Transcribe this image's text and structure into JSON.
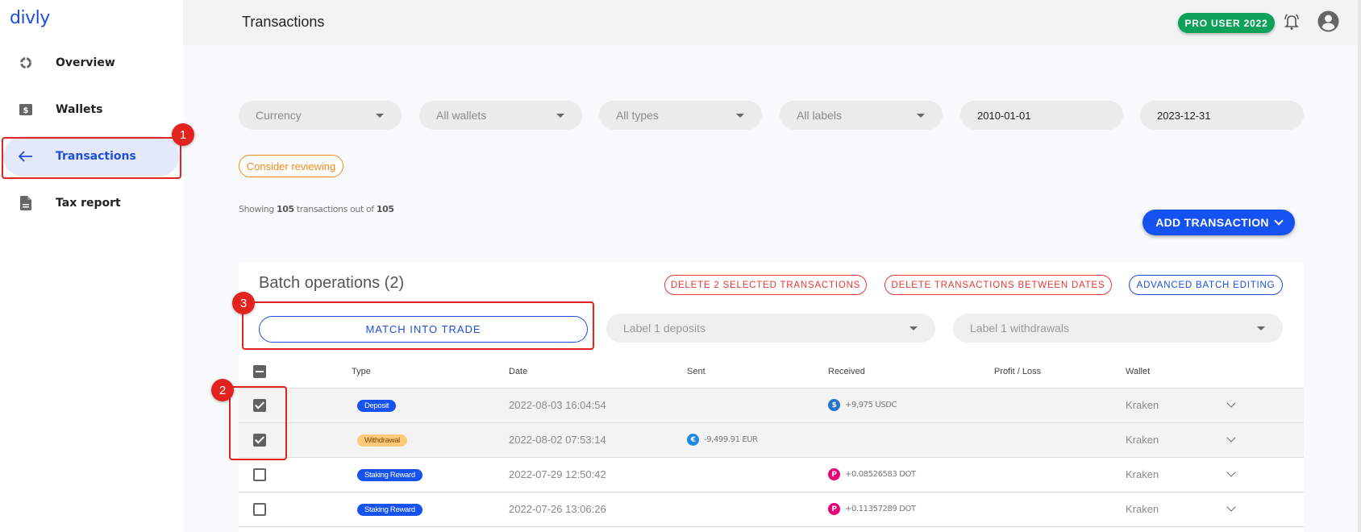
{
  "app": {
    "logo": "divly",
    "page_title": "Transactions"
  },
  "sidebar": {
    "items": [
      {
        "label": "Overview",
        "icon": "overview-ring-icon",
        "active": false
      },
      {
        "label": "Wallets",
        "icon": "wallet-dollar-icon",
        "active": false
      },
      {
        "label": "Transactions",
        "icon": "arrow-left-icon",
        "active": true
      },
      {
        "label": "Tax report",
        "icon": "document-icon",
        "active": false
      }
    ]
  },
  "topbar": {
    "badge": "PRO USER 2022",
    "badge_color": "#0ea15a",
    "icons": [
      "bell-icon",
      "account-circle-icon"
    ]
  },
  "filters": {
    "currency": {
      "placeholder": "Currency"
    },
    "wallets": {
      "value": "All wallets"
    },
    "types": {
      "value": "All types"
    },
    "labels": {
      "value": "All labels"
    },
    "date_from": "2010-01-01",
    "date_to": "2023-12-31"
  },
  "review_chip": "Consider reviewing",
  "summary": {
    "prefix": "Showing",
    "shown": "105",
    "middle": "transactions out of",
    "total": "105"
  },
  "add_transaction": "ADD TRANSACTION",
  "batch": {
    "title": "Batch operations (2)",
    "delete_selected": "DELETE 2 SELECTED TRANSACTIONS",
    "delete_between": "DELETE TRANSACTIONS BETWEEN DATES",
    "advanced": "ADVANCED BATCH EDITING",
    "match": "MATCH INTO TRADE",
    "label_deposits": "Label 1 deposits",
    "label_withdrawals": "Label 1 withdrawals"
  },
  "table": {
    "columns": [
      "Type",
      "Date",
      "Sent",
      "Received",
      "Profit / Loss",
      "Wallet"
    ],
    "rows": [
      {
        "selected": true,
        "type": "Deposit",
        "type_style": "blue",
        "date": "2022-08-03 16:04:54",
        "sent": "",
        "sent_coin": "",
        "received": "+9,975 USDC",
        "received_coin": "usdc",
        "profit_loss": "",
        "wallet": "Kraken"
      },
      {
        "selected": true,
        "type": "Withdrawal",
        "type_style": "orange",
        "date": "2022-08-02 07:53:14",
        "sent": "-9,499.91 EUR",
        "sent_coin": "eur",
        "received": "",
        "received_coin": "",
        "profit_loss": "",
        "wallet": "Kraken"
      },
      {
        "selected": false,
        "type": "Staking Reward",
        "type_style": "blue",
        "date": "2022-07-29 12:50:42",
        "sent": "",
        "sent_coin": "",
        "received": "+0.08526583 DOT",
        "received_coin": "dot",
        "profit_loss": "",
        "wallet": "Kraken"
      },
      {
        "selected": false,
        "type": "Staking Reward",
        "type_style": "blue",
        "date": "2022-07-26 13:06:26",
        "sent": "",
        "sent_coin": "",
        "received": "+0.11357289 DOT",
        "received_coin": "dot",
        "profit_loss": "",
        "wallet": "Kraken"
      }
    ]
  },
  "annotations": [
    "1",
    "2",
    "3"
  ],
  "colors": {
    "primary": "#1652f0",
    "danger": "#e53935",
    "warning": "#f08a1c",
    "annotation": "#e3231f"
  }
}
